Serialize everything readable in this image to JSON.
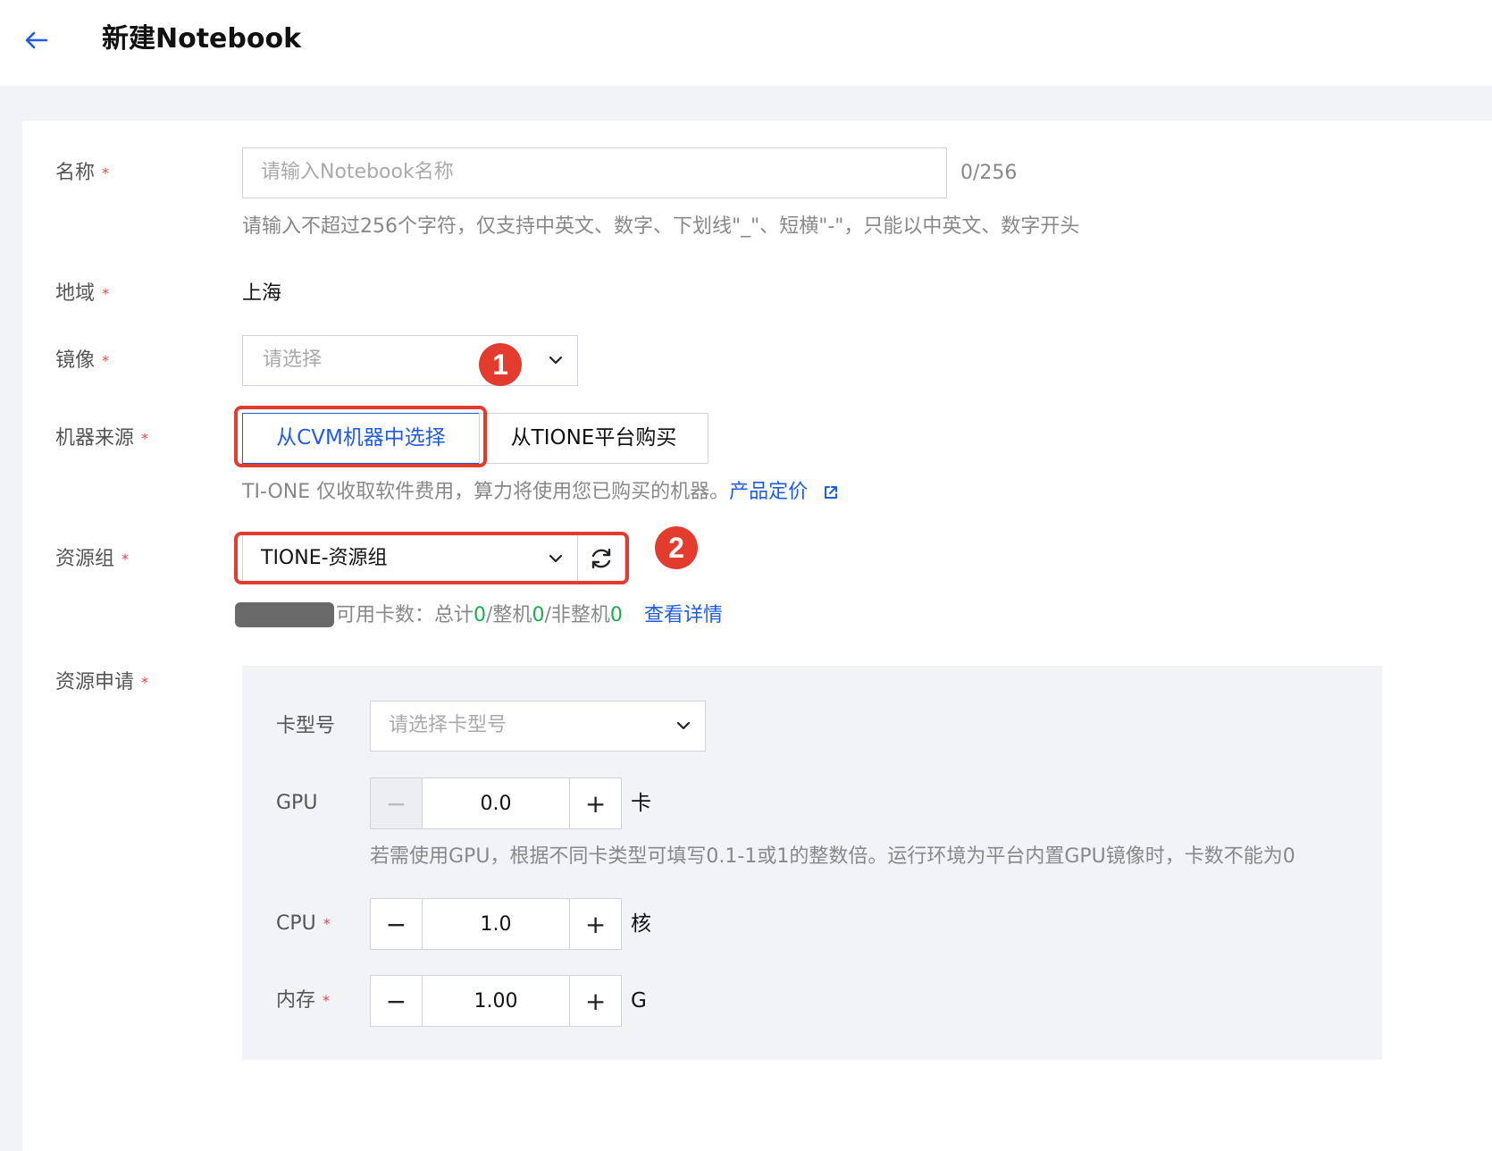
{
  "header": {
    "title": "新建Notebook",
    "back_icon": "arrow-left-icon"
  },
  "form": {
    "required_mark": "*",
    "name": {
      "label": "名称",
      "placeholder": "请输入Notebook名称",
      "counter": "0/256",
      "hint": "请输入不超过256个字符，仅支持中英文、数字、下划线\"_\"、短横\"-\"，只能以中英文、数字开头"
    },
    "region": {
      "label": "地域",
      "value": "上海"
    },
    "image": {
      "label": "镜像",
      "placeholder": "请选择"
    },
    "machine_source": {
      "label": "机器来源",
      "options": [
        "从CVM机器中选择",
        "从TIONE平台购买"
      ],
      "selected": "从CVM机器中选择",
      "hint": "TI-ONE 仅收取软件费用，算力将使用您已购买的机器。",
      "pricing_link": "产品定价"
    },
    "resource_group": {
      "label": "资源组",
      "value": "TIONE-资源组",
      "available_prefix": "可用卡数：总计",
      "total": "0",
      "whole_label": "/整机",
      "whole": "0",
      "partial_label": "/非整机",
      "partial": "0",
      "details_link": "查看详情"
    },
    "resource_request": {
      "label": "资源申请",
      "card_type": {
        "label": "卡型号",
        "placeholder": "请选择卡型号"
      },
      "gpu": {
        "label": "GPU",
        "value": "0.0",
        "unit": "卡",
        "hint": "若需使用GPU，根据不同卡类型可填写0.1-1或1的整数倍。运行环境为平台内置GPU镜像时，卡数不能为0"
      },
      "cpu": {
        "label": "CPU",
        "value": "1.0",
        "unit": "核"
      },
      "memory": {
        "label": "内存",
        "value": "1.00",
        "unit": "G"
      },
      "minus": "−",
      "plus": "+"
    }
  },
  "annotations": {
    "badge_1": "1",
    "badge_2": "2",
    "box_color": "#e33b2e"
  },
  "colors": {
    "accent": "#1f5ce0",
    "required": "#e54545",
    "available_count": "#1aad4c"
  }
}
